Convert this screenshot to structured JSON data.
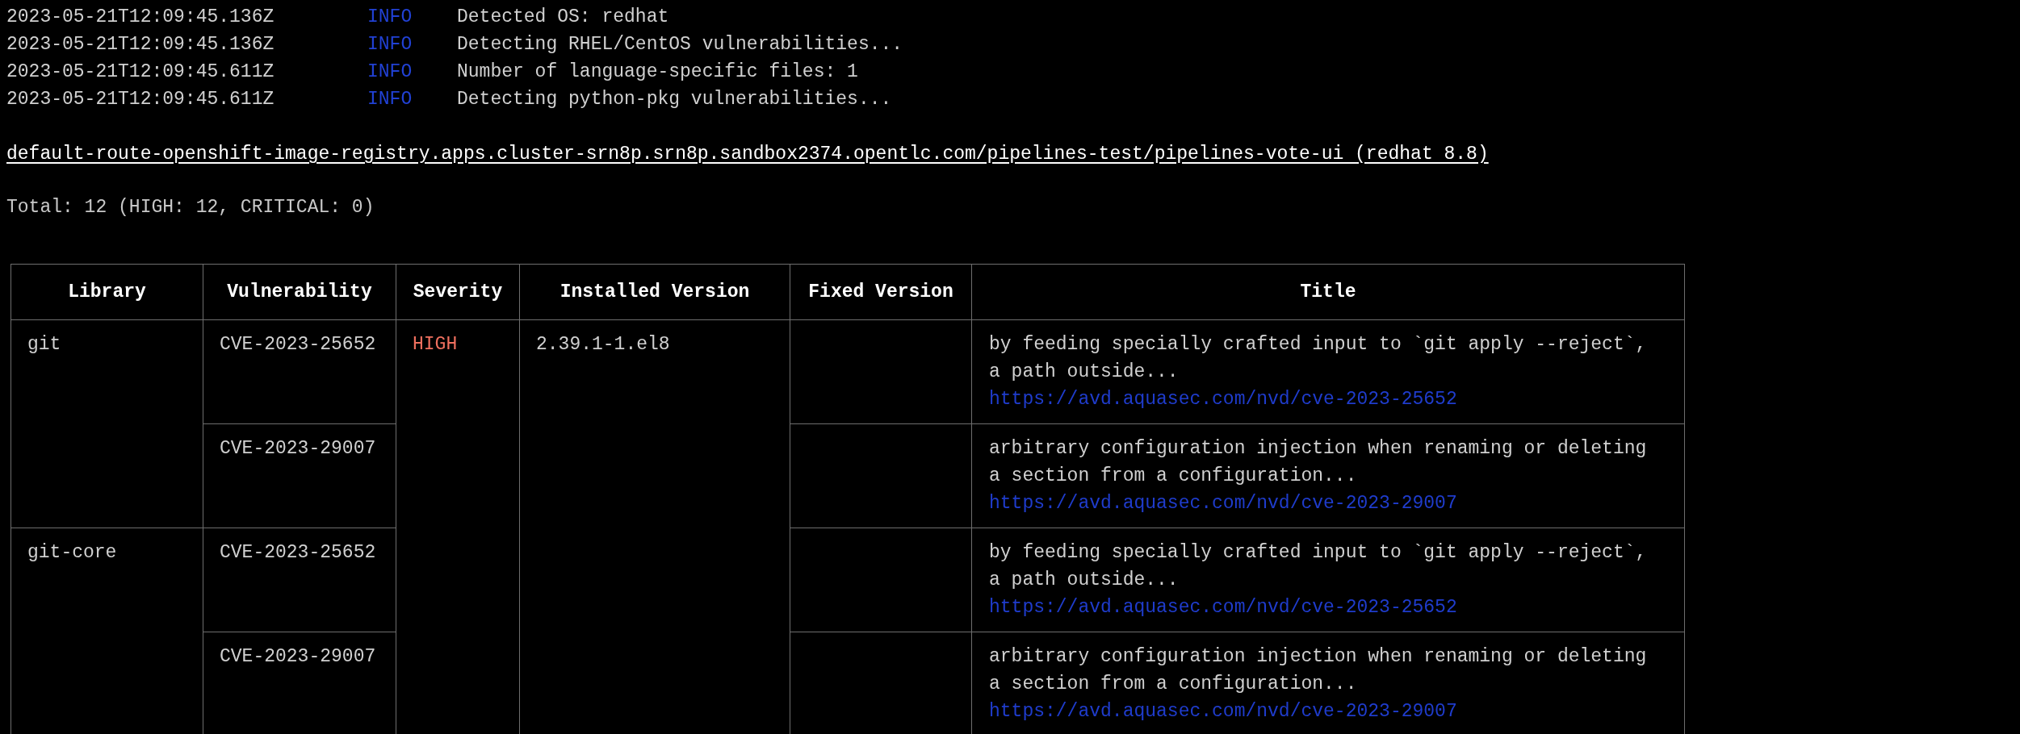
{
  "log_lines": [
    {
      "timestamp": "2023-05-21T12:09:45.136Z",
      "level": "INFO",
      "message": "Detected OS: redhat"
    },
    {
      "timestamp": "2023-05-21T12:09:45.136Z",
      "level": "INFO",
      "message": "Detecting RHEL/CentOS vulnerabilities..."
    },
    {
      "timestamp": "2023-05-21T12:09:45.611Z",
      "level": "INFO",
      "message": "Number of language-specific files: 1"
    },
    {
      "timestamp": "2023-05-21T12:09:45.611Z",
      "level": "INFO",
      "message": "Detecting python-pkg vulnerabilities..."
    }
  ],
  "target": "default-route-openshift-image-registry.apps.cluster-srn8p.srn8p.sandbox2374.opentlc.com/pipelines-test/pipelines-vote-ui (redhat 8.8)",
  "summary": "Total: 12 (HIGH: 12, CRITICAL: 0)",
  "table": {
    "columns": [
      "Library",
      "Vulnerability",
      "Severity",
      "Installed Version",
      "Fixed Version",
      "Title"
    ],
    "groups": [
      {
        "severity": "HIGH",
        "installed_version": "2.39.1-1.el8",
        "libraries": [
          {
            "name": "git",
            "vulnerabilities": [
              {
                "id": "CVE-2023-25652",
                "title": "by feeding specially crafted input to `git apply --reject`, a path outside...",
                "url": "https://avd.aquasec.com/nvd/cve-2023-25652"
              },
              {
                "id": "CVE-2023-29007",
                "title": "arbitrary configuration injection when renaming or deleting a section from a configuration...",
                "url": "https://avd.aquasec.com/nvd/cve-2023-29007"
              }
            ]
          },
          {
            "name": "git-core",
            "vulnerabilities": [
              {
                "id": "CVE-2023-25652",
                "title": "by feeding specially crafted input to `git apply --reject`, a path outside...",
                "url": "https://avd.aquasec.com/nvd/cve-2023-25652"
              },
              {
                "id": "CVE-2023-29007",
                "title": "arbitrary configuration injection when renaming or deleting a section from a configuration...",
                "url": "https://avd.aquasec.com/nvd/cve-2023-29007"
              }
            ]
          }
        ]
      }
    ]
  }
}
